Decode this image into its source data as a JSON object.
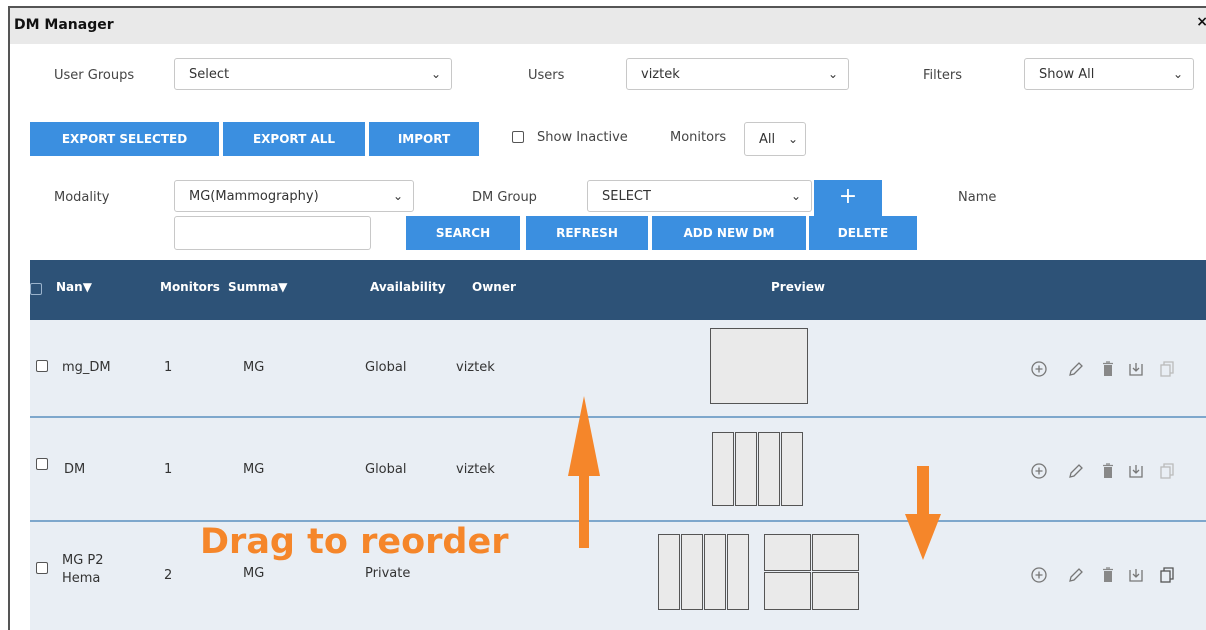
{
  "window": {
    "title": "DM Manager",
    "close_glyph": "×"
  },
  "filters": {
    "user_groups_label": "User Groups",
    "user_groups_value": "Select",
    "users_label": "Users",
    "users_value": "viztek",
    "filters_label": "Filters",
    "filters_value": "Show All"
  },
  "toolbar": {
    "export_selected": "EXPORT SELECTED",
    "export_all": "EXPORT ALL",
    "import": "IMPORT",
    "show_inactive_label": "Show Inactive",
    "show_inactive_checked": false,
    "monitors_label": "Monitors",
    "monitors_value": "All"
  },
  "search": {
    "modality_label": "Modality",
    "modality_value": "MG(Mammography)",
    "dm_group_label": "DM Group",
    "dm_group_value": "SELECT",
    "add_group_glyph": "+",
    "name_label": "Name",
    "name_value": "",
    "search_btn": "SEARCH",
    "refresh_btn": "REFRESH",
    "add_new_btn": "ADD NEW DM",
    "delete_btn": "DELETE"
  },
  "table": {
    "headers": {
      "name": "Nan",
      "monitors": "Monitors",
      "summary": "Summa",
      "availability": "Availability",
      "owner": "Owner",
      "preview": "Preview"
    },
    "rows": [
      {
        "name": "mg_DM",
        "monitors": "1",
        "summary": "MG",
        "availability": "Global",
        "owner": "viztek"
      },
      {
        "name": "DM",
        "monitors": "1",
        "summary": "MG",
        "availability": "Global",
        "owner": "viztek"
      },
      {
        "name": "MG P2 Hema",
        "monitors": "2",
        "summary": "MG",
        "availability": "Private",
        "owner": ""
      }
    ]
  },
  "annotation": {
    "text": "Drag to reorder",
    "color": "#f5862a"
  },
  "colors": {
    "button": "#3b8fe0",
    "header": "#2d5277",
    "row": "#e9eef4",
    "divider": "#7ea7cc"
  },
  "row_icons": [
    "plus-circle-icon",
    "pencil-icon",
    "trash-icon",
    "download-icon",
    "copy-icon"
  ]
}
